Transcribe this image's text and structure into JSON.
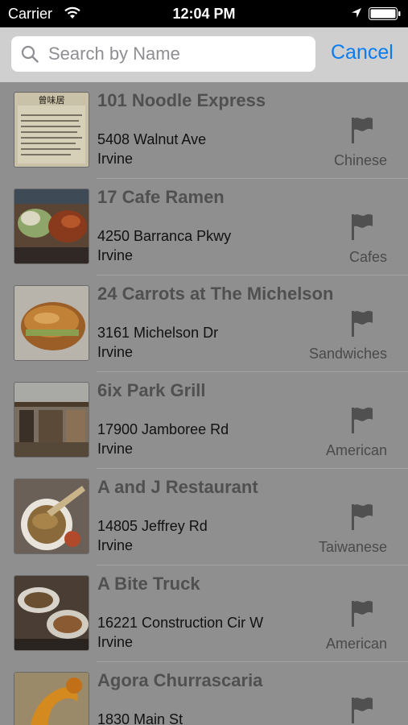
{
  "status_bar": {
    "carrier": "Carrier",
    "time": "12:04 PM"
  },
  "search": {
    "placeholder": "Search by Name",
    "cancel_label": "Cancel"
  },
  "restaurants": [
    {
      "name": "101 Noodle Express",
      "address": "5408 Walnut Ave",
      "city": "Irvine",
      "category": "Chinese",
      "thumb_sign": "曾味居"
    },
    {
      "name": "17 Cafe Ramen",
      "address": "4250 Barranca Pkwy",
      "city": "Irvine",
      "category": "Cafes"
    },
    {
      "name": "24 Carrots at The Michelson",
      "address": "3161 Michelson Dr",
      "city": "Irvine",
      "category": "Sandwiches"
    },
    {
      "name": "6ix Park Grill",
      "address": "17900 Jamboree Rd",
      "city": "Irvine",
      "category": "American"
    },
    {
      "name": "A and J Restaurant",
      "address": "14805 Jeffrey Rd",
      "city": "Irvine",
      "category": "Taiwanese"
    },
    {
      "name": "A Bite Truck",
      "address": "16221 Construction Cir W",
      "city": "Irvine",
      "category": "American"
    },
    {
      "name": "Agora Churrascaria",
      "address": "1830 Main St",
      "city": "",
      "category": ""
    }
  ]
}
